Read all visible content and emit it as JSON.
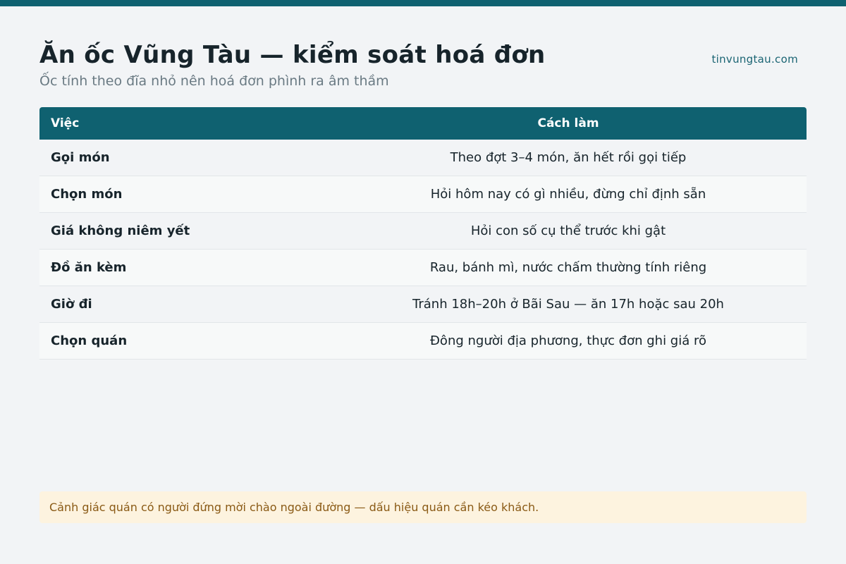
{
  "header": {
    "title": "Ăn ốc Vũng Tàu — kiểm soát hoá đơn",
    "subtitle": "Ốc tính theo đĩa nhỏ nên hoá đơn phình ra âm thầm",
    "site": "tinvungtau.com"
  },
  "table": {
    "columns": [
      "Việc",
      "Cách làm"
    ],
    "rows": [
      {
        "task": "Gọi món",
        "how": "Theo đợt 3–4 món, ăn hết rồi gọi tiếp"
      },
      {
        "task": "Chọn món",
        "how": "Hỏi hôm nay có gì nhiều, đừng chỉ định sẵn"
      },
      {
        "task": "Giá không niêm yết",
        "how": "Hỏi con số cụ thể trước khi gật"
      },
      {
        "task": "Đồ ăn kèm",
        "how": "Rau, bánh mì, nước chấm thường tính riêng"
      },
      {
        "task": "Giờ đi",
        "how": "Tránh 18h–20h ở Bãi Sau — ăn 17h hoặc sau 20h"
      },
      {
        "task": "Chọn quán",
        "how": "Đông người địa phương, thực đơn ghi giá rõ"
      }
    ]
  },
  "note": "Cảnh giác quán có người đứng mời chào ngoài đường — dấu hiệu quán cần kéo khách.",
  "colors": {
    "accent": "#0f6170",
    "note_bg": "#fdf3df",
    "note_text": "#8a5a15"
  }
}
